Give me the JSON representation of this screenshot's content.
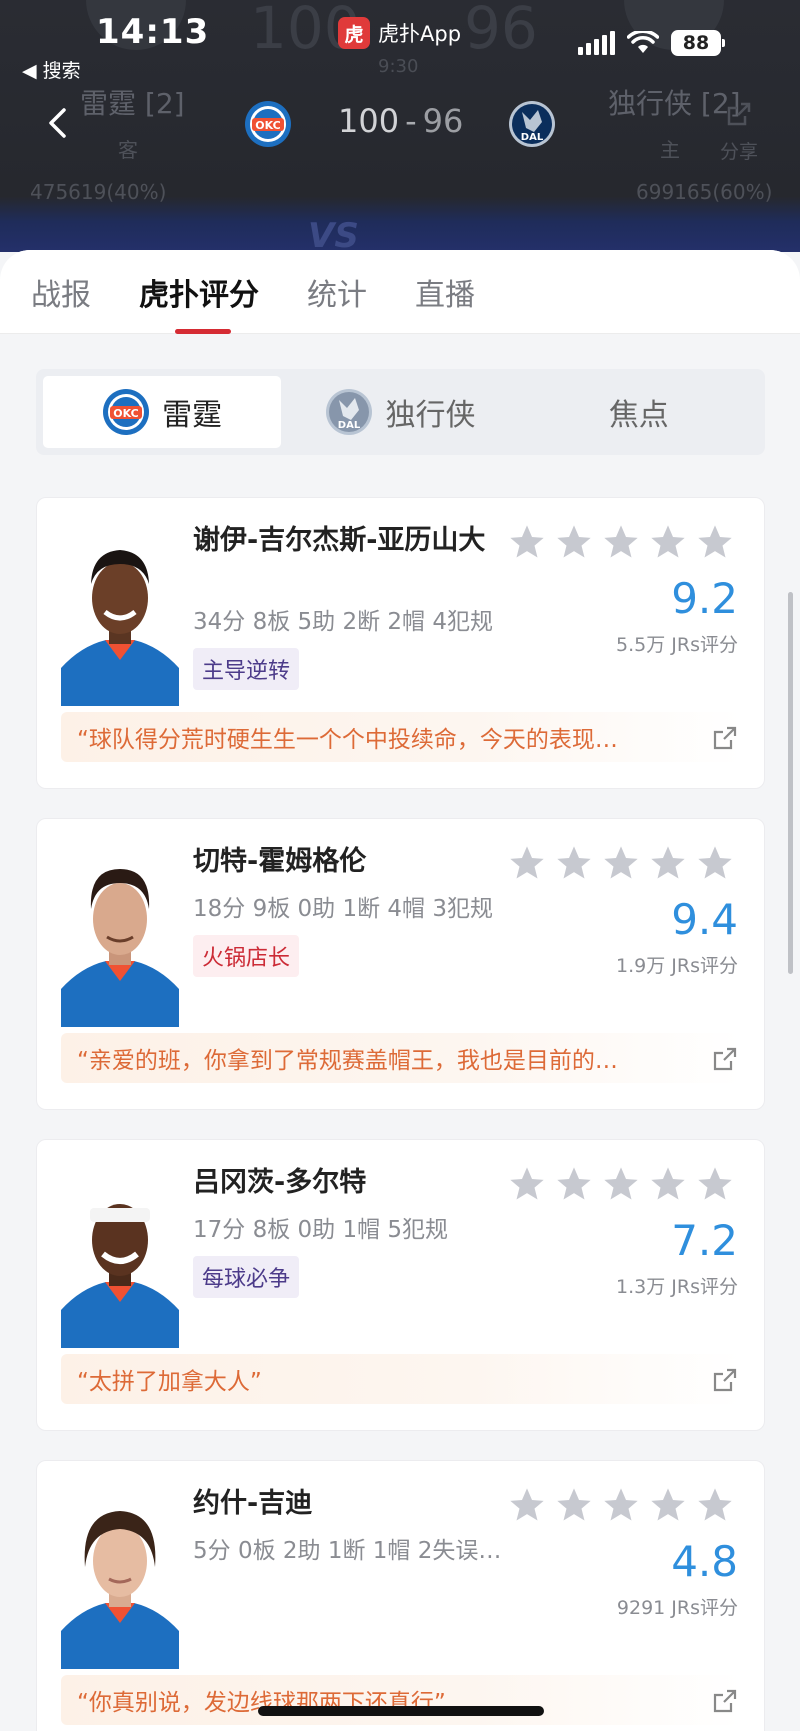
{
  "status_bar": {
    "time": "14:13",
    "back_app": "搜索",
    "app_badge": "虎扑App",
    "battery": "88"
  },
  "game": {
    "clock": "9:30",
    "score_home": "100",
    "score_away": "96",
    "score_sep": "-",
    "away_team": {
      "name": "雷霆 [2]",
      "side": "客",
      "abbr": "OKC",
      "votes": "475619(40%)"
    },
    "home_team": {
      "name": "独行侠 [2]",
      "side": "主",
      "abbr": "DAL",
      "votes": "699165(60%)"
    },
    "share_label": "分享",
    "vs_label": "VS"
  },
  "tabs": [
    {
      "label": "战报"
    },
    {
      "label": "虎扑评分"
    },
    {
      "label": "统计"
    },
    {
      "label": "直播"
    }
  ],
  "segment": [
    {
      "label": "雷霆",
      "logo": "OKC"
    },
    {
      "label": "独行侠",
      "logo": "DAL"
    },
    {
      "label": "焦点"
    }
  ],
  "players": [
    {
      "name": "谢伊-吉尔杰斯-亚历山大",
      "stats": "34分 8板 5助 2断 2帽 4犯规",
      "tag": "主导逆转",
      "rating": "9.2",
      "count": "5.5万 JRs评分",
      "quote": "“球队得分荒时硬生生一个个中投续命，今天的表现…"
    },
    {
      "name": "切特-霍姆格伦",
      "stats": "18分 9板 0助 1断 4帽 3犯规",
      "tag": "火锅店长",
      "rating": "9.4",
      "count": "1.9万 JRs评分",
      "quote": "“亲爱的班，你拿到了常规赛盖帽王，我也是目前的…"
    },
    {
      "name": "吕冈茨-多尔特",
      "stats": "17分 8板 0助 1帽 5犯规",
      "tag": "每球必争",
      "rating": "7.2",
      "count": "1.3万 JRs评分",
      "quote": "“太拼了加拿大人”"
    },
    {
      "name": "约什-吉迪",
      "stats": "5分 0板 2助 1断 1帽 2失误…",
      "tag": "",
      "rating": "4.8",
      "count": "9291 JRs评分",
      "quote": "“你真别说，发边线球那两下还真行”"
    }
  ],
  "colors": {
    "accent": "#d52b33",
    "rating_blue": "#2f8fdd",
    "quote_orange": "#dd6a37",
    "okc_blue": "#1d6fc0",
    "dal_navy": "#0b2e5c"
  }
}
